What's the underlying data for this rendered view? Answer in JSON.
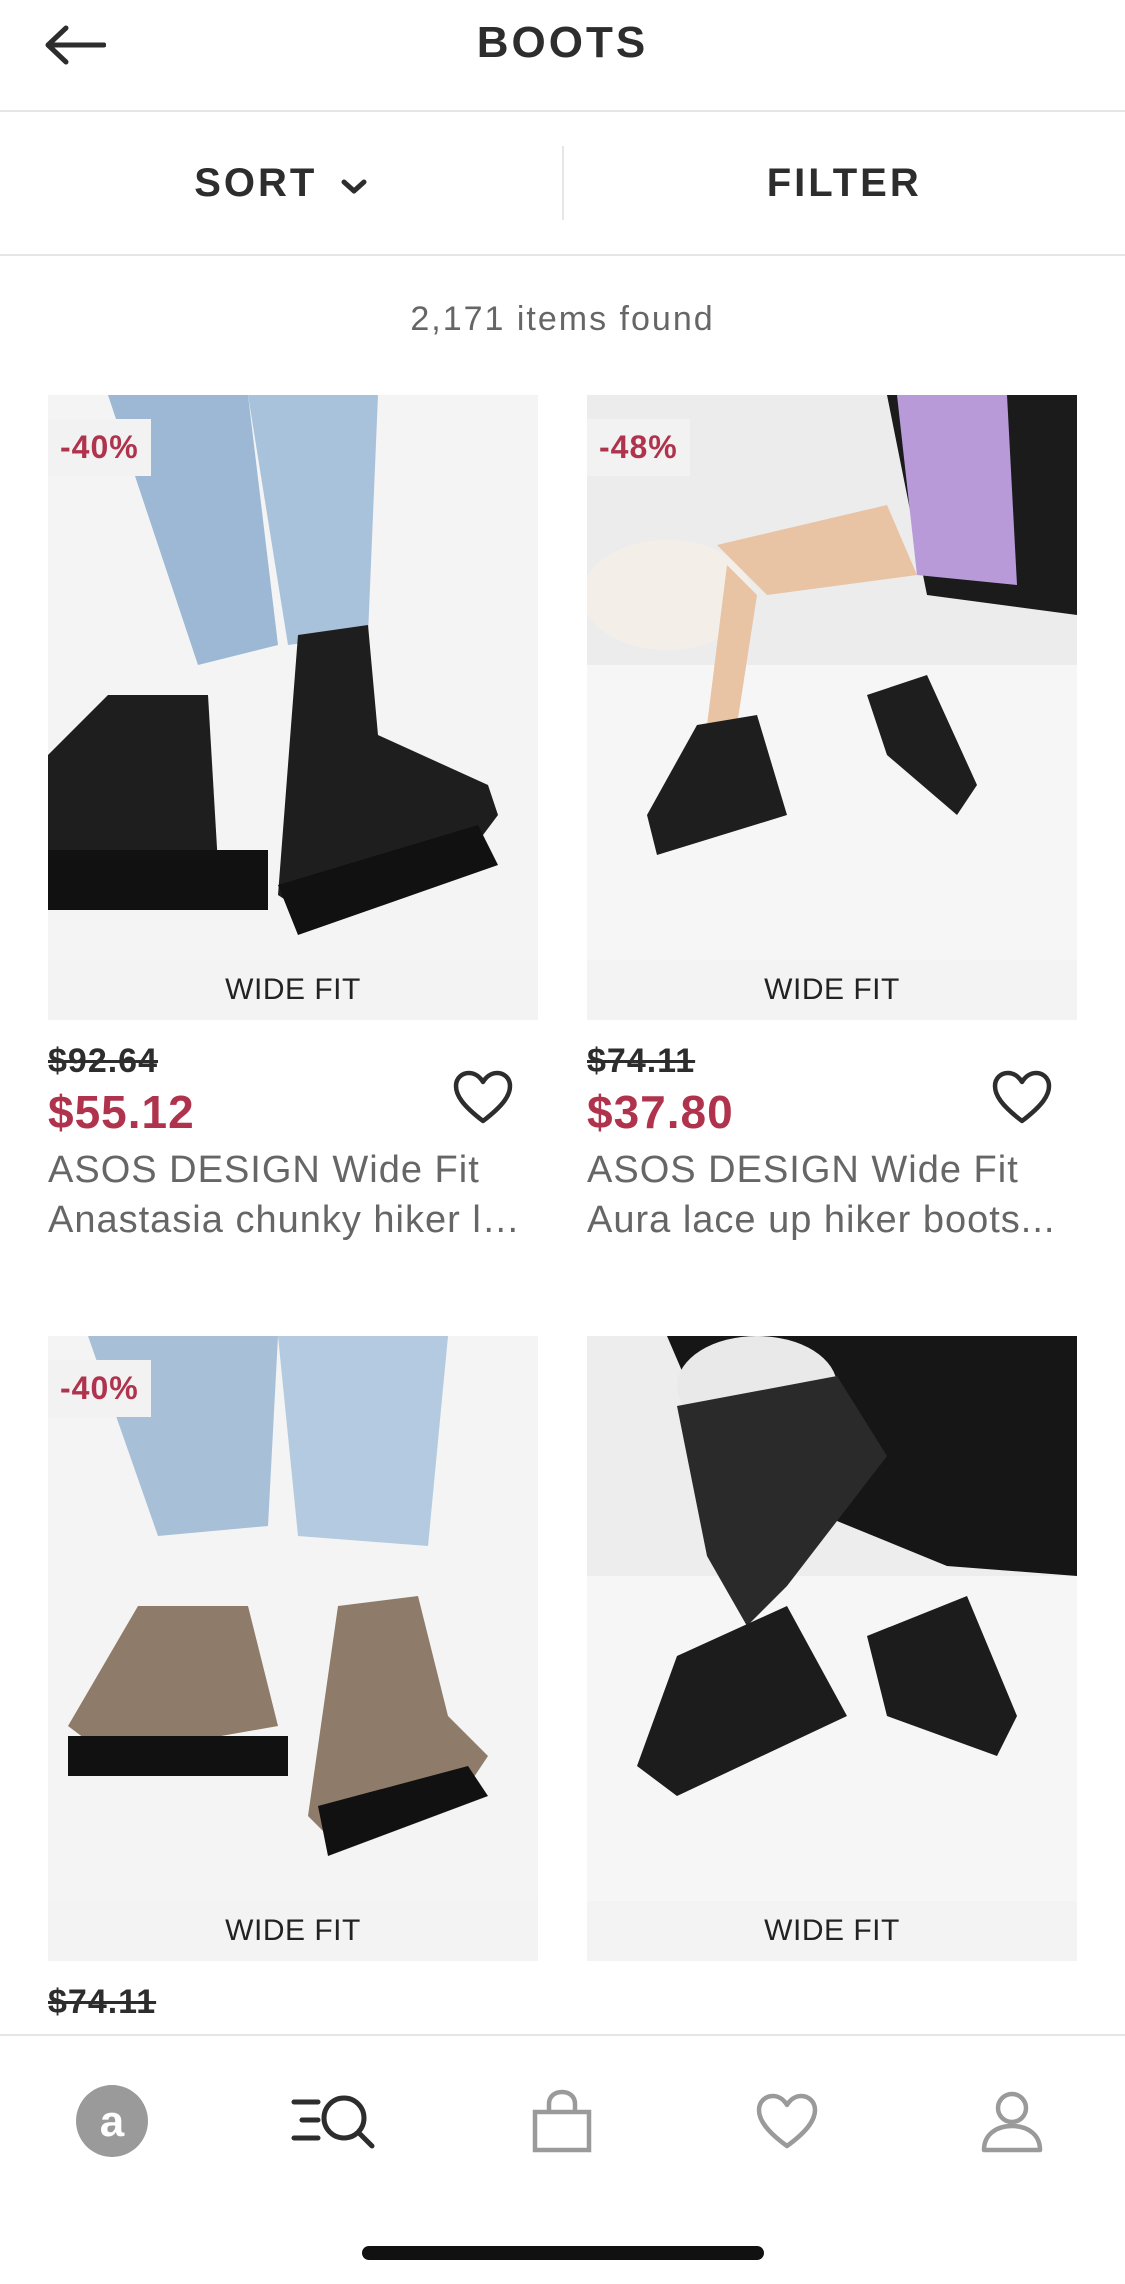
{
  "header": {
    "title": "BOOTS"
  },
  "toolbar": {
    "sort_label": "SORT",
    "filter_label": "FILTER"
  },
  "results": {
    "count_text": "2,171 items found"
  },
  "products": [
    {
      "discount": "-40%",
      "fit": "WIDE FIT",
      "old_price": "$92.64",
      "price": "$55.12",
      "name_line1": "ASOS DESIGN Wide Fit",
      "name_line2": "Anastasia chunky hiker la..."
    },
    {
      "discount": "-48%",
      "fit": "WIDE FIT",
      "old_price": "$74.11",
      "price": "$37.80",
      "name_line1": "ASOS DESIGN Wide Fit",
      "name_line2": "Aura lace up hiker boots..."
    },
    {
      "discount": "-40%",
      "fit": "WIDE FIT",
      "old_price": "$74.11"
    },
    {
      "fit": "WIDE FIT"
    }
  ],
  "nav": {
    "home_letter": "a"
  },
  "colors": {
    "sale": "#b0334d",
    "text": "#2d2d2d",
    "muted": "#666666"
  }
}
